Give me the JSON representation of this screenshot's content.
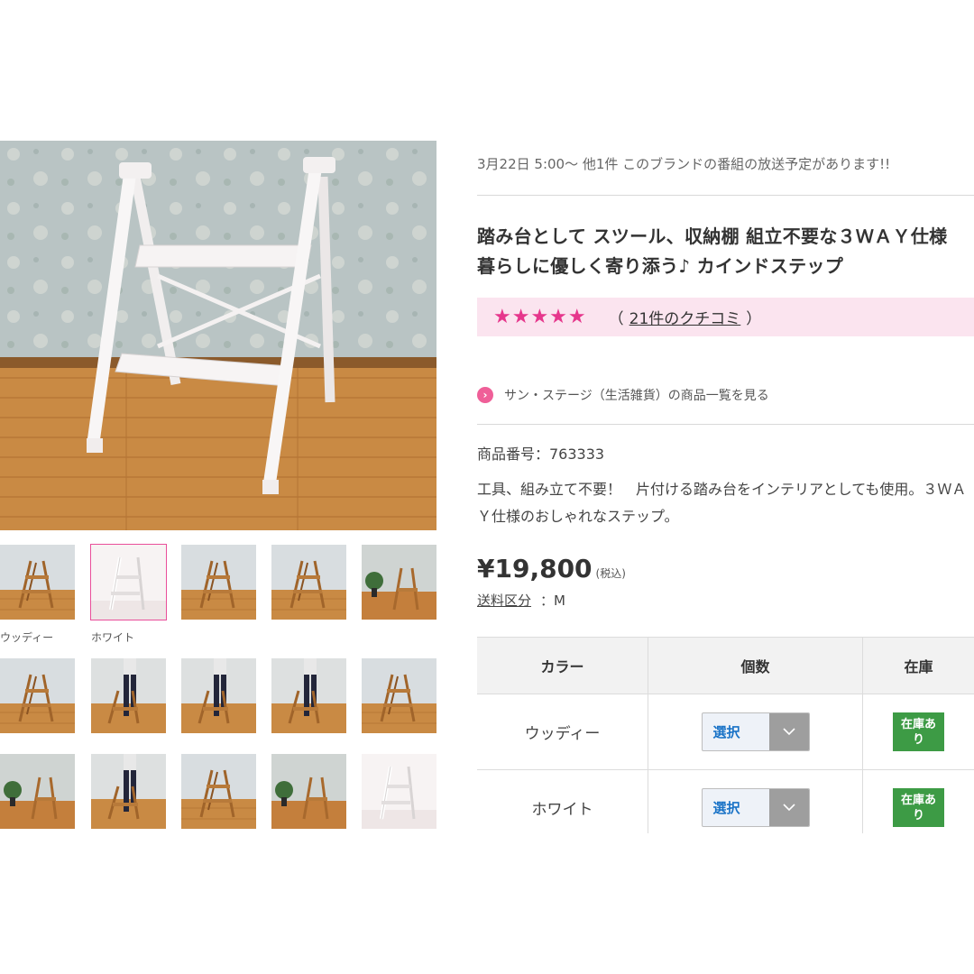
{
  "gallery": {
    "thumb_labels": [
      "ウッディー",
      "ホワイト"
    ]
  },
  "broadcast": "3月22日 5:00〜  他1件  このブランドの番組の放送予定があります!!",
  "product": {
    "title": "踏み台として スツール、収納棚 組立不要な３ＷＡＹ仕様 暮らしに優しく寄り添う♪ カインドステップ",
    "stars": "★★★★★",
    "review_open": "（",
    "review_link": "21件のクチコミ",
    "review_close": "）",
    "brand_link": "サン・ステージ（生活雑貨）の商品一覧を見る",
    "item_number": "商品番号：763333",
    "description": "工具、組み立て不要！　片付ける踏み台をインテリアとしても使用。３ＷＡＹ仕様のおしゃれなステップ。",
    "price": "¥19,800",
    "tax_note": "(税込)",
    "shipping_label": "送料区分",
    "shipping_value": "：M"
  },
  "options_table": {
    "headers": [
      "カラー",
      "個数",
      "在庫"
    ],
    "rows": [
      {
        "color": "ウッディー",
        "select": "選択",
        "stock": "在庫あり"
      },
      {
        "color": "ホワイト",
        "select": "選択",
        "stock": "在庫あり"
      }
    ]
  },
  "colors": {
    "accent_pink": "#e6368c",
    "rating_bg": "#fbe4ef",
    "stock_green": "#3d9b45",
    "select_text": "#1a73c7"
  }
}
